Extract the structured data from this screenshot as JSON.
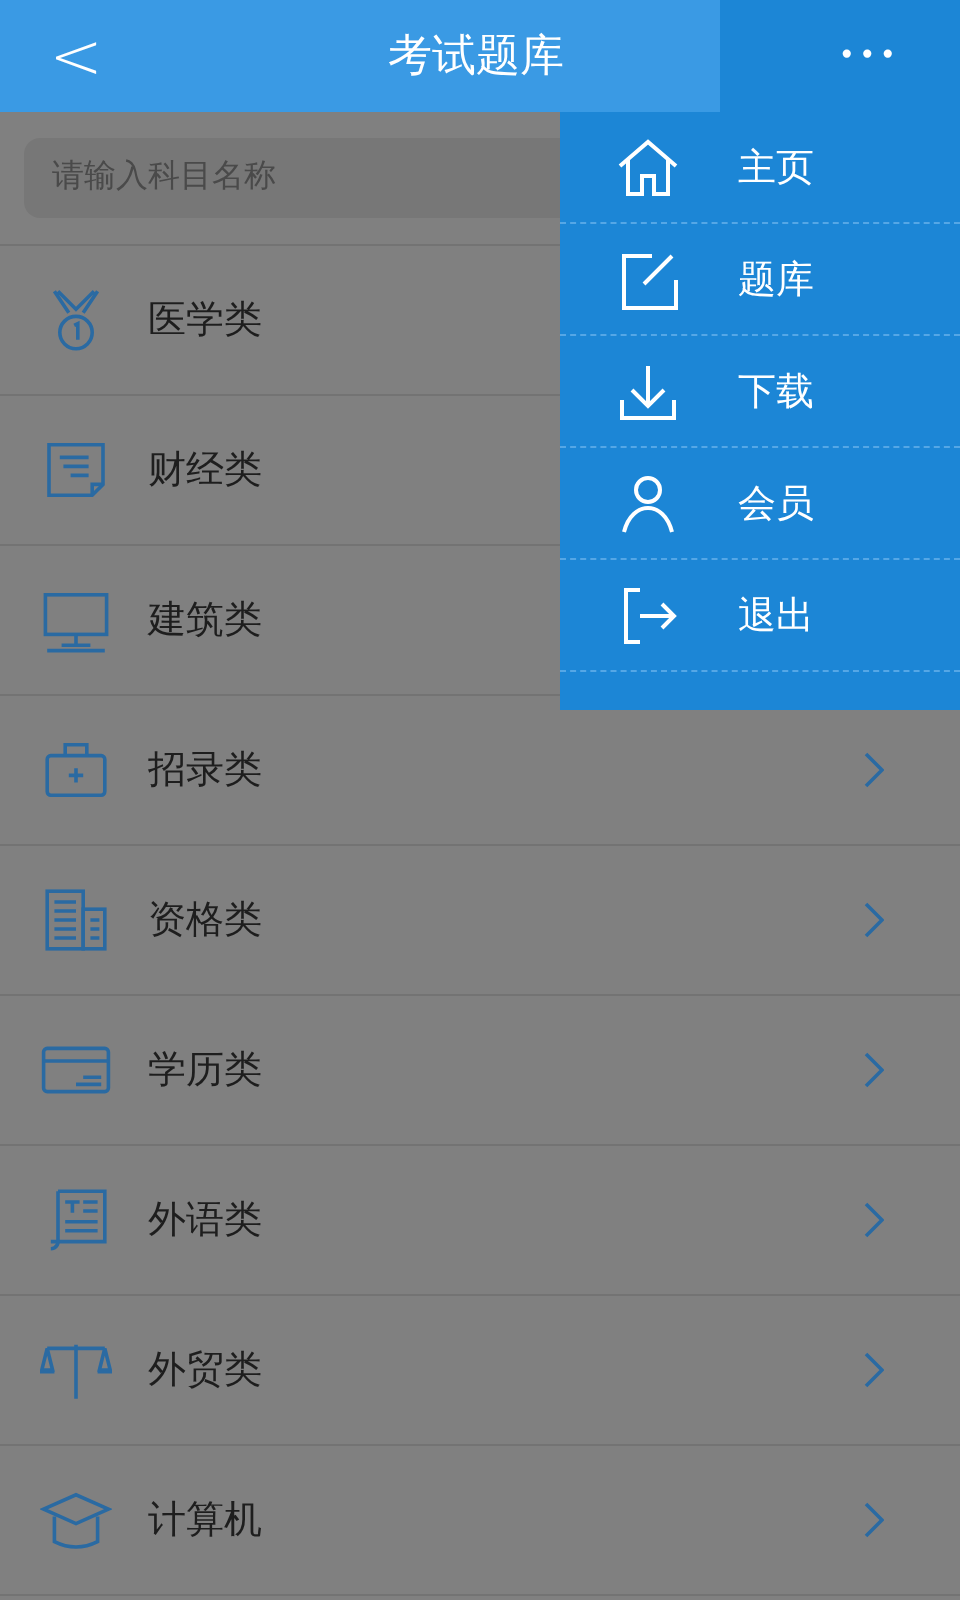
{
  "header": {
    "back": "<",
    "title": "考试题库",
    "more": "•••"
  },
  "search": {
    "placeholder": "请输入科目名称"
  },
  "categories": [
    {
      "label": "医学类",
      "chevron": false
    },
    {
      "label": "财经类",
      "chevron": false
    },
    {
      "label": "建筑类",
      "chevron": false
    },
    {
      "label": "招录类",
      "chevron": true
    },
    {
      "label": "资格类",
      "chevron": true
    },
    {
      "label": "学历类",
      "chevron": true
    },
    {
      "label": "外语类",
      "chevron": true
    },
    {
      "label": "外贸类",
      "chevron": true
    },
    {
      "label": "计算机",
      "chevron": true
    }
  ],
  "menu": [
    {
      "label": "主页"
    },
    {
      "label": "题库"
    },
    {
      "label": "下载"
    },
    {
      "label": "会员"
    },
    {
      "label": "退出"
    }
  ]
}
